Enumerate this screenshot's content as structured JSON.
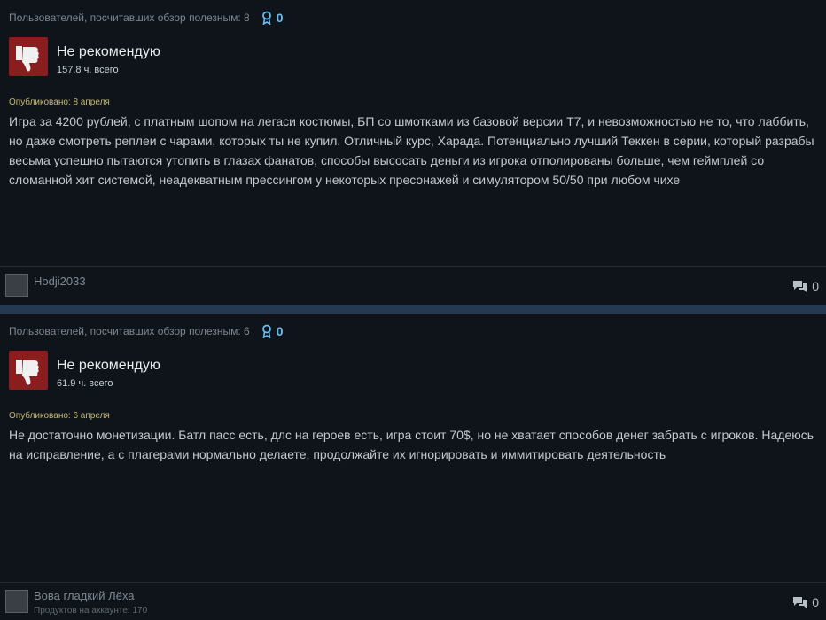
{
  "reviews": [
    {
      "helpful_text": "Пользователей, посчитавших обзор полезным: 8",
      "awards": "0",
      "verdict": "Не рекомендую",
      "hours": "157.8 ч. всего",
      "posted": "Опубликовано: 8 апреля",
      "text": "Игра за 4200 рублей, с платным шопом на легаси костюмы, БП со шмотками из базовой версии Т7, и невозможностью не то, что лаббить, но даже смотреть реплеи с чарами, которых ты не купил. Отличный курс, Харада. Потенциально лучший Теккен в серии, который разрабы весьма успешно пытаются утопить в глазах фанатов, способы высосать деньги из игрока отполированы больше, чем геймплей со сломанной хит системой, неадекватным прессингом у некоторых пресонажей и симулятором 50/50 при любом чихе",
      "author": "Hodji2033",
      "comments": "0"
    },
    {
      "helpful_text": "Пользователей, посчитавших обзор полезным: 6",
      "awards": "0",
      "verdict": "Не рекомендую",
      "hours": "61.9 ч. всего",
      "posted": "Опубликовано: 6 апреля",
      "text": "Не достаточно монетизации. Батл пасс есть, длс на героев есть, игра стоит 70$, но не хватает способов денег забрать с игроков. Надеюсь на исправление, а с плагерами нормально делаете, продолжайте их игнорировать и иммитировать деятельность",
      "author": "Вова гладкий Лёха",
      "products": "Продуктов на аккаунте: 170",
      "comments": "0"
    }
  ],
  "colors": {
    "accent": "#66c0f4",
    "thumb_bg": "#8a1d1d",
    "separator": "#253a52"
  }
}
